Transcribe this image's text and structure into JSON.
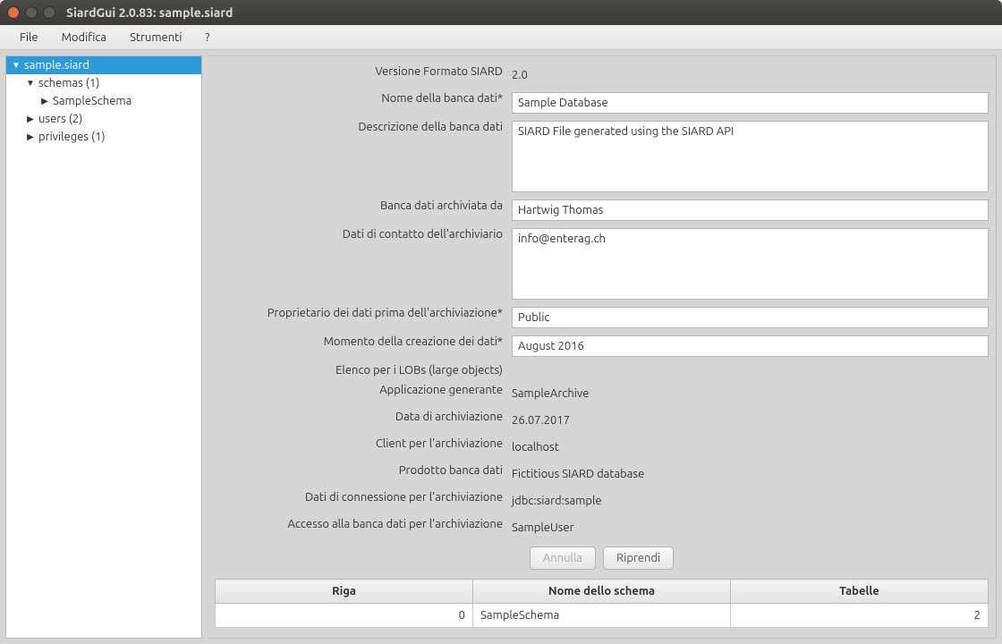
{
  "window": {
    "title": "SiardGui 2.0.83: sample.siard"
  },
  "menubar": {
    "file": "File",
    "edit": "Modifica",
    "tools": "Strumenti",
    "help": "?"
  },
  "tree": {
    "root": "sample.siard",
    "schemas": "schemas (1)",
    "sampleschema": "SampleSchema",
    "users": "users (2)",
    "privileges": "privileges (1)"
  },
  "form": {
    "labels": {
      "siard_version": "Versione Formato SIARD",
      "db_name": "Nome della banca dati*",
      "db_description": "Descrizione della banca dati",
      "archived_by": "Banca dati archiviata da",
      "archiver_contact": "Dati di contatto dell'archiviario",
      "owner_before": "Proprietario dei dati prima dell'archiviazione*",
      "creation_time": "Momento della creazione dei dati*",
      "lobs": "Elenco per i LOBs (large objects)",
      "generating_app": "Applicazione generante",
      "archive_date": "Data di archiviazione",
      "archive_client": "Client per l'archiviazione",
      "db_product": "Prodotto banca dati",
      "connection": "Dati di connessione per l'archiviazione",
      "db_access": "Accesso alla banca dati per l'archiviazione"
    },
    "values": {
      "siard_version": "2.0",
      "db_name": "Sample Database",
      "db_description": "SIARD File generated using the SIARD API",
      "archived_by": "Hartwig Thomas",
      "archiver_contact": "info@enterag.ch",
      "owner_before": "Public",
      "creation_time": "August 2016",
      "lobs": "",
      "generating_app": "SampleArchive",
      "archive_date": "26.07.2017",
      "archive_client": "localhost",
      "db_product": "Fictitious SIARD database",
      "connection": "jdbc:siard:sample",
      "db_access": "SampleUser"
    }
  },
  "buttons": {
    "cancel": "Annulla",
    "resume": "Riprendi"
  },
  "table": {
    "headers": {
      "row": "Riga",
      "schema": "Nome dello schema",
      "tables": "Tabelle"
    },
    "rows": [
      {
        "idx": "0",
        "schema": "SampleSchema",
        "tables": "2"
      }
    ]
  }
}
